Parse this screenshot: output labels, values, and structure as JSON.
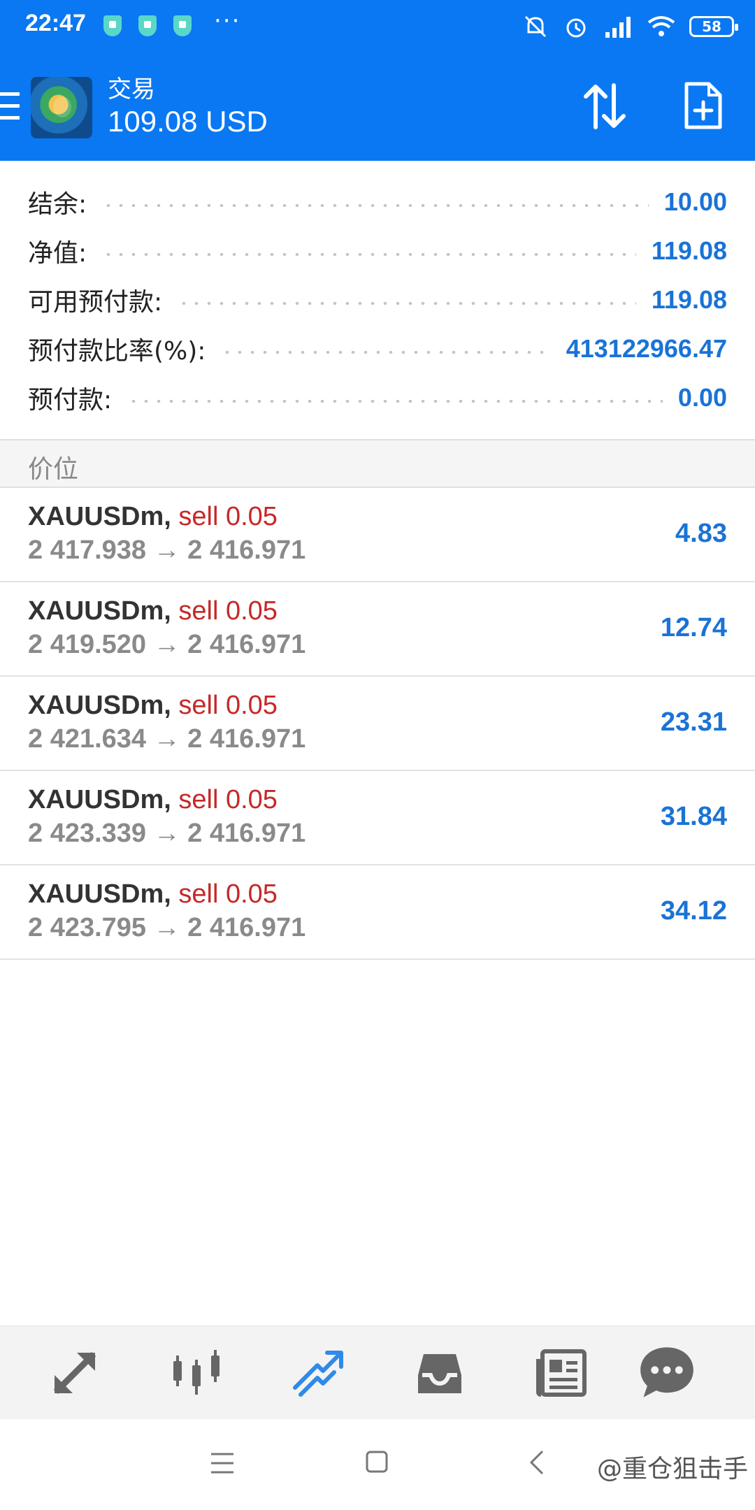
{
  "status": {
    "time": "22:47",
    "dots": "···",
    "battery": "58"
  },
  "header": {
    "title": "交易",
    "subtitle": "109.08 USD"
  },
  "summary": [
    {
      "label": "结余:",
      "value": "10.00"
    },
    {
      "label": "净值:",
      "value": "119.08"
    },
    {
      "label": "可用预付款:",
      "value": "119.08"
    },
    {
      "label": "预付款比率(%):",
      "value": "413122966.47"
    },
    {
      "label": "预付款:",
      "value": "0.00"
    }
  ],
  "section": {
    "title": "价位"
  },
  "positions": [
    {
      "symbol": "XAUUSDm",
      "comma": ",",
      "direction": "sell 0.05",
      "prices": "2 417.938 → 2 416.971",
      "profit": "4.83"
    },
    {
      "symbol": "XAUUSDm",
      "comma": ",",
      "direction": "sell 0.05",
      "prices": "2 419.520 → 2 416.971",
      "profit": "12.74"
    },
    {
      "symbol": "XAUUSDm",
      "comma": ",",
      "direction": "sell 0.05",
      "prices": "2 421.634 → 2 416.971",
      "profit": "23.31"
    },
    {
      "symbol": "XAUUSDm",
      "comma": ",",
      "direction": "sell 0.05",
      "prices": "2 423.339 → 2 416.971",
      "profit": "31.84"
    },
    {
      "symbol": "XAUUSDm",
      "comma": ",",
      "direction": "sell 0.05",
      "prices": "2 423.795 → 2 416.971",
      "profit": "34.12"
    }
  ],
  "nav": {
    "items": [
      "quotes-icon",
      "chart-icon",
      "trade-icon",
      "history-icon",
      "news-icon",
      "chat-icon"
    ],
    "active": "trade-icon"
  },
  "watermark": "@重仓狙击手",
  "colors": {
    "primary": "#0a78f2",
    "profit": "#1a73d6",
    "sell": "#c62828"
  }
}
